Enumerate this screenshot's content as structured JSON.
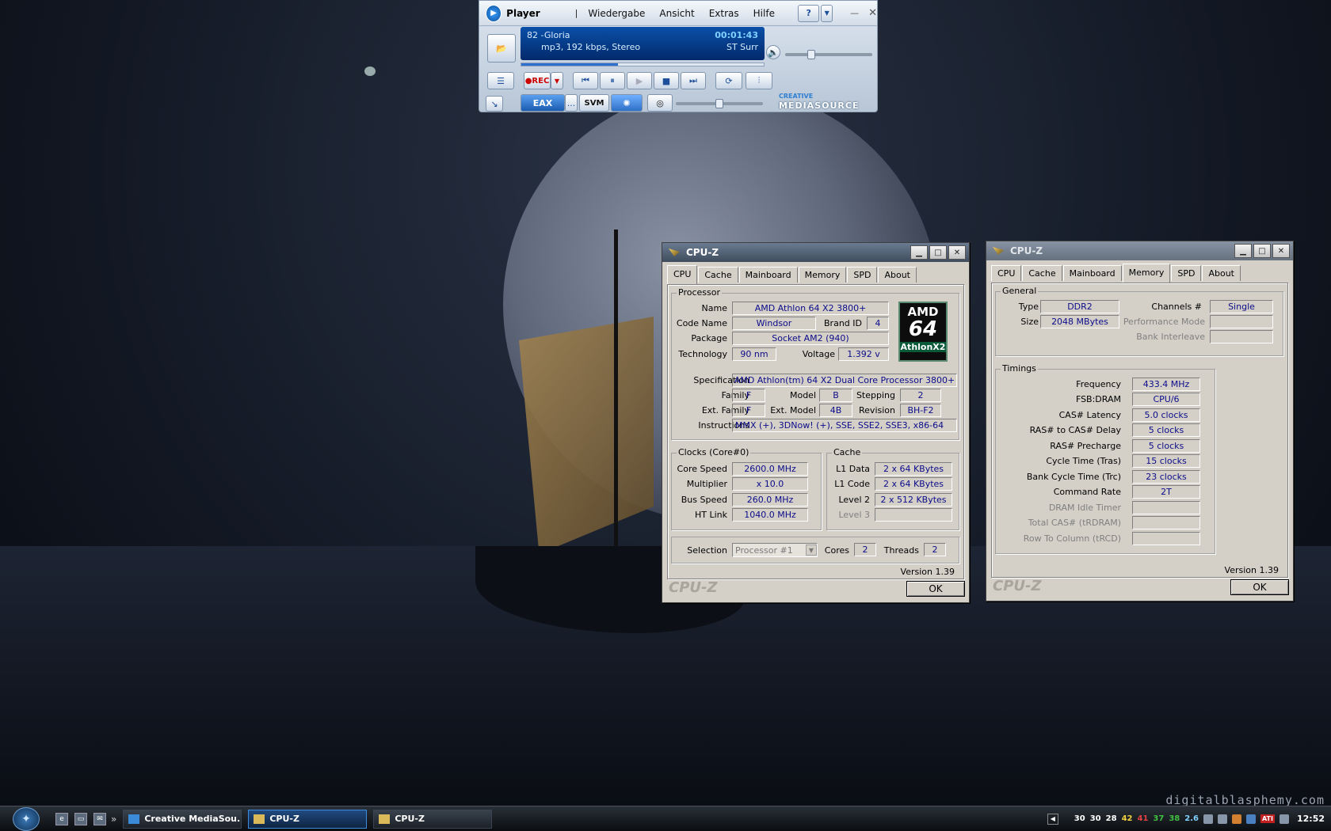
{
  "watermark": "digitalblasphemy.com",
  "player": {
    "name": "Player",
    "menu": [
      "Wiedergabe",
      "Ansicht",
      "Extras",
      "Hilfe"
    ],
    "help_label": "?",
    "track_title": "82 -Gloria",
    "track_info": "mp3, 192 kbps, Stereo",
    "time": "00:01:43",
    "mode": "ST Surr",
    "rec_label": "●REC",
    "eax_label": "EAX",
    "more_label": "...",
    "svm_label": "SVM",
    "brand_top": "CREATIVE",
    "brand_bottom": "MEDIASOURCE",
    "seek_fraction": 0.4,
    "volume_fraction": 0.3,
    "balance_fraction": 0.5
  },
  "cpuz1": {
    "title": "CPU-Z",
    "tabs": [
      "CPU",
      "Cache",
      "Mainboard",
      "Memory",
      "SPD",
      "About"
    ],
    "active_tab": "CPU",
    "processor": {
      "legend": "Processor",
      "name_label": "Name",
      "name": "AMD Athlon 64 X2 3800+",
      "codename_label": "Code Name",
      "codename": "Windsor",
      "brandid_label": "Brand ID",
      "brandid": "4",
      "package_label": "Package",
      "package": "Socket AM2 (940)",
      "technology_label": "Technology",
      "technology": "90 nm",
      "voltage_label": "Voltage",
      "voltage": "1.392 v",
      "spec_label": "Specification",
      "spec": "AMD Athlon(tm) 64 X2 Dual Core Processor 3800+",
      "family_label": "Family",
      "family": "F",
      "model_label": "Model",
      "model": "B",
      "stepping_label": "Stepping",
      "stepping": "2",
      "extfamily_label": "Ext. Family",
      "extfamily": "F",
      "extmodel_label": "Ext. Model",
      "extmodel": "4B",
      "revision_label": "Revision",
      "revision": "BH-F2",
      "instructions_label": "Instructions",
      "instructions": "MMX (+), 3DNow! (+), SSE, SSE2, SSE3, x86-64"
    },
    "logo": {
      "brand": "AMD",
      "num": "64",
      "line": "AthlonX2"
    },
    "clocks": {
      "legend": "Clocks (Core#0)",
      "core_speed_label": "Core Speed",
      "core_speed": "2600.0 MHz",
      "multiplier_label": "Multiplier",
      "multiplier": "x 10.0",
      "bus_speed_label": "Bus Speed",
      "bus_speed": "260.0 MHz",
      "ht_link_label": "HT Link",
      "ht_link": "1040.0 MHz"
    },
    "cache": {
      "legend": "Cache",
      "l1data_label": "L1 Data",
      "l1data": "2 x 64 KBytes",
      "l1code_label": "L1 Code",
      "l1code": "2 x 64 KBytes",
      "level2_label": "Level 2",
      "level2": "2 x 512 KBytes",
      "level3_label": "Level 3",
      "level3": ""
    },
    "selection_label": "Selection",
    "selection": "Processor #1",
    "cores_label": "Cores",
    "cores": "2",
    "threads_label": "Threads",
    "threads": "2",
    "version": "Version 1.39",
    "brand": "CPU-Z",
    "ok": "OK"
  },
  "cpuz2": {
    "title": "CPU-Z",
    "tabs": [
      "CPU",
      "Cache",
      "Mainboard",
      "Memory",
      "SPD",
      "About"
    ],
    "active_tab": "Memory",
    "general": {
      "legend": "General",
      "type_label": "Type",
      "type": "DDR2",
      "size_label": "Size",
      "size": "2048 MBytes",
      "channels_label": "Channels #",
      "channels": "Single",
      "perf_label": "Performance Mode",
      "perf": "",
      "bank_label": "Bank Interleave",
      "bank": ""
    },
    "timings": {
      "legend": "Timings",
      "frequency_label": "Frequency",
      "frequency": "433.4 MHz",
      "fsb_label": "FSB:DRAM",
      "fsb": "CPU/6",
      "cas_label": "CAS# Latency",
      "cas": "5.0 clocks",
      "rcd_label": "RAS# to CAS# Delay",
      "rcd": "5 clocks",
      "rp_label": "RAS# Precharge",
      "rp": "5 clocks",
      "tras_label": "Cycle Time (Tras)",
      "tras": "15 clocks",
      "trc_label": "Bank Cycle Time (Trc)",
      "trc": "23 clocks",
      "cr_label": "Command Rate",
      "cr": "2T",
      "idle_label": "DRAM Idle Timer",
      "idle": "",
      "totalcas_label": "Total CAS# (tRDRAM)",
      "totalcas": "",
      "r2c_label": "Row To Column (tRCD)",
      "r2c": ""
    },
    "version": "Version 1.39",
    "brand": "CPU-Z",
    "ok": "OK"
  },
  "taskbar": {
    "tasks": [
      "Creative MediaSou...",
      "CPU-Z",
      "CPU-Z"
    ],
    "active_task": 1,
    "tray_numbers": [
      "30",
      "30",
      "28",
      "42",
      "41",
      "37",
      "38",
      "2.6"
    ],
    "tray_colors": [
      "#ffffff",
      "#ffffff",
      "#ffffff",
      "#f0d040",
      "#e04040",
      "#40c040",
      "#40c040",
      "#80d0ff"
    ],
    "ati_label": "ATI",
    "clock": "12:52"
  }
}
